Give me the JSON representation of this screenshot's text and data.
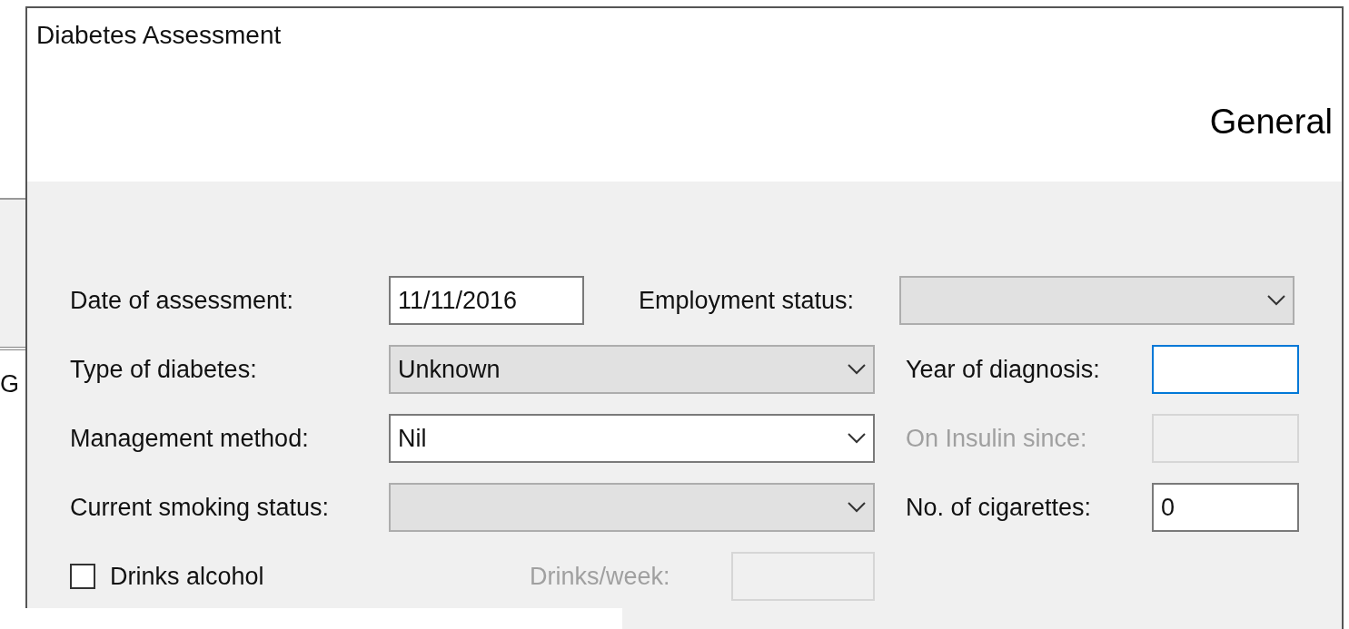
{
  "background_window": {
    "text": "G"
  },
  "window": {
    "title": "Diabetes Assessment"
  },
  "header": {
    "title": "General"
  },
  "rows": [
    {
      "kind": "first",
      "left": {
        "kind": "textbox",
        "label": "Date of assessment:",
        "value": "11/11/2016",
        "disabled": false,
        "focused": false
      },
      "right": {
        "kind": "dropdown",
        "label": "Employment status:",
        "editable": false
      }
    },
    {
      "kind": "standard",
      "left": {
        "kind": "dropdown",
        "label": "Type of diabetes:",
        "value": "Unknown",
        "editable": false
      },
      "right": {
        "kind": "textbox",
        "label": "Year of diagnosis:",
        "disabled": false,
        "focused": true
      }
    },
    {
      "kind": "standard",
      "left": {
        "kind": "dropdown",
        "label": "Management method:",
        "value": "Nil",
        "editable": true
      },
      "right": {
        "kind": "textbox",
        "label": "On Insulin since:",
        "disabled": true,
        "focused": false
      }
    },
    {
      "kind": "standard",
      "left": {
        "kind": "dropdown",
        "label": "Current smoking status:",
        "editable": false
      },
      "right": {
        "kind": "textbox",
        "label": "No. of cigarettes:",
        "value": "0",
        "disabled": false,
        "focused": false
      }
    },
    {
      "kind": "checkbox",
      "left": {
        "kind": "checkbox",
        "label": "Drinks alcohol",
        "checked": false
      },
      "right": {
        "kind": "textbox",
        "label": "Drinks/week:",
        "disabled": true,
        "focused": false
      }
    }
  ]
}
